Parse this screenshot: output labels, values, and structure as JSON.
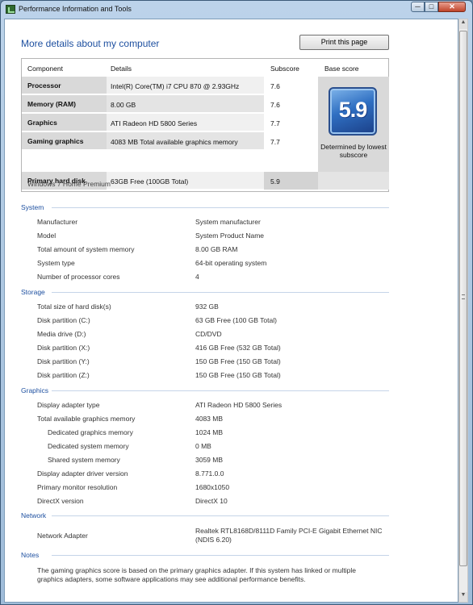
{
  "window": {
    "title": "Performance Information and Tools",
    "min_label": "─",
    "max_label": "□",
    "close_label": "✕"
  },
  "page": {
    "heading": "More details about my computer",
    "print_label": "Print this page"
  },
  "score_table": {
    "headers": [
      "Component",
      "Details",
      "Subscore",
      "Base score"
    ],
    "rows": [
      {
        "component": "Processor",
        "details": "Intel(R) Core(TM) i7 CPU 870 @ 2.93GHz",
        "subscore": "7.6"
      },
      {
        "component": "Memory (RAM)",
        "details": "8.00 GB",
        "subscore": "7.6"
      },
      {
        "component": "Graphics",
        "details": "ATI Radeon HD 5800 Series",
        "subscore": "7.7"
      },
      {
        "component": "Gaming graphics",
        "details": "4083 MB Total available graphics memory",
        "subscore": "7.7"
      },
      {
        "component": "Primary hard disk",
        "details": "63GB Free (100GB Total)",
        "subscore": "5.9"
      }
    ],
    "base_score": "5.9",
    "base_caption": "Determined by lowest subscore",
    "os_edition": "Windows 7 Home Premium"
  },
  "system": {
    "title": "System",
    "rows": [
      {
        "label": "Manufacturer",
        "value": "System manufacturer"
      },
      {
        "label": "Model",
        "value": "System Product Name"
      },
      {
        "label": "Total amount of system memory",
        "value": "8.00 GB RAM"
      },
      {
        "label": "System type",
        "value": "64-bit operating system"
      },
      {
        "label": "Number of processor cores",
        "value": "4"
      }
    ]
  },
  "storage": {
    "title": "Storage",
    "rows": [
      {
        "label": "Total size of hard disk(s)",
        "value": "932 GB"
      },
      {
        "label": "Disk partition (C:)",
        "value": "63 GB Free (100 GB Total)"
      },
      {
        "label": "Media drive (D:)",
        "value": "CD/DVD"
      },
      {
        "label": "Disk partition (X:)",
        "value": "416 GB Free (532 GB Total)"
      },
      {
        "label": "Disk partition (Y:)",
        "value": "150 GB Free (150 GB Total)"
      },
      {
        "label": "Disk partition (Z:)",
        "value": "150 GB Free (150 GB Total)"
      }
    ]
  },
  "graphics": {
    "title": "Graphics",
    "rows": [
      {
        "label": "Display adapter type",
        "value": "ATI Radeon HD 5800 Series"
      },
      {
        "label": "Total available graphics memory",
        "value": "4083 MB"
      },
      {
        "label": "Dedicated graphics memory",
        "value": "1024 MB"
      },
      {
        "label": "Dedicated system memory",
        "value": "0 MB"
      },
      {
        "label": "Shared system memory",
        "value": "3059 MB"
      },
      {
        "label": "Display adapter driver version",
        "value": "8.771.0.0"
      },
      {
        "label": "Primary monitor resolution",
        "value": "1680x1050"
      },
      {
        "label": "DirectX version",
        "value": "DirectX 10"
      }
    ]
  },
  "network": {
    "title": "Network",
    "rows": [
      {
        "label": "Network Adapter",
        "value_line1": "Realtek RTL8168D/8111D Family PCI-E Gigabit Ethernet NIC",
        "value_line2": "(NDIS 6.20)"
      }
    ]
  },
  "notes": {
    "title": "Notes",
    "text": "The gaming graphics score is based on the primary graphics adapter. If this system has linked or multiple graphics adapters, some software applications may see additional performance benefits."
  }
}
